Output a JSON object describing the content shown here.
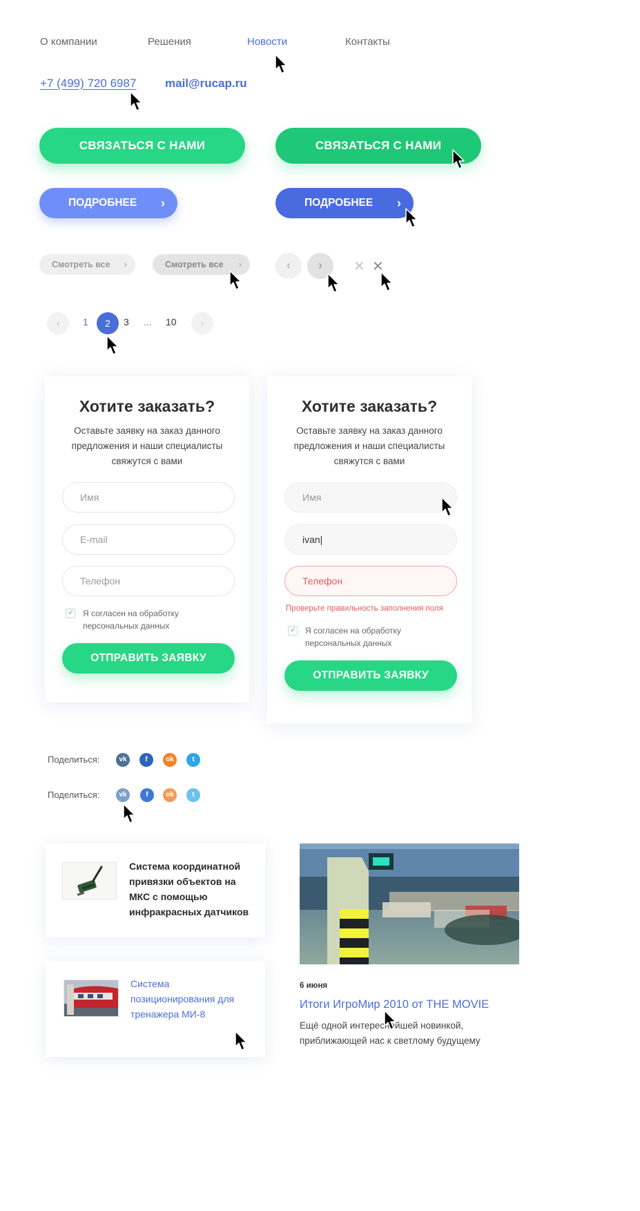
{
  "nav": {
    "items": [
      {
        "label": "О компании"
      },
      {
        "label": "Решения"
      },
      {
        "label": "Новости"
      },
      {
        "label": "Контакты"
      }
    ]
  },
  "contacts": {
    "phone": "+7 (499) 720 6987",
    "email": "mail@rucap.ru"
  },
  "buttons": {
    "contact_label": "СВЯЗАТЬСЯ С НАМИ",
    "more_label": "ПОДРОБНЕЕ",
    "view_all_label": "Смотреть все",
    "chevron_right": "›",
    "chevron_left": "‹",
    "close_glyph": "✕"
  },
  "pagination": {
    "pages": [
      "1",
      "2",
      "3",
      "...",
      "10"
    ],
    "current": "2"
  },
  "forms": [
    {
      "title": "Хотите заказать?",
      "subtitle": "Оставьте заявку на заказ данного предложения и наши специалисты свяжутся с вами",
      "name_placeholder": "Имя",
      "email_placeholder": "E-mail",
      "phone_placeholder": "Телефон",
      "consent": "Я согласен на обработку персональных данных",
      "submit": "ОТПРАВИТЬ ЗАЯВКУ"
    },
    {
      "title": "Хотите заказать?",
      "subtitle": "Оставьте заявку на заказ данного предложения и наши специалисты свяжутся с вами",
      "name_placeholder": "Имя",
      "email_value": "ivan|",
      "phone_placeholder": "Телефон",
      "error": "Проверьте правильность заполнения поля",
      "consent": "Я согласен на обработку персональных данных",
      "submit": "ОТПРАВИТЬ ЗАЯВКУ"
    }
  ],
  "share": {
    "label": "Поделиться:",
    "icons": [
      "vk-icon",
      "facebook-icon",
      "odnoklassniki-icon",
      "twitter-icon"
    ],
    "glyphs": {
      "vk": "vk",
      "fb": "f",
      "ok": "ok",
      "tw": "t"
    }
  },
  "news": {
    "card1": "Система координатной привязки объектов на МКС с помощью инфракрасных датчиков",
    "card2": "Система позиционирования для тренажера МИ-8",
    "featured": {
      "date": "6 июня",
      "title": "Итоги ИгроМир 2010 от THE MOVIE",
      "description": "Ещё одной интереснейшей новинкой, приближающей нас к светлому будущему"
    }
  },
  "colors": {
    "accent_blue": "#4a6ed8",
    "green": "#27d785",
    "error_red": "#e65c5c"
  }
}
